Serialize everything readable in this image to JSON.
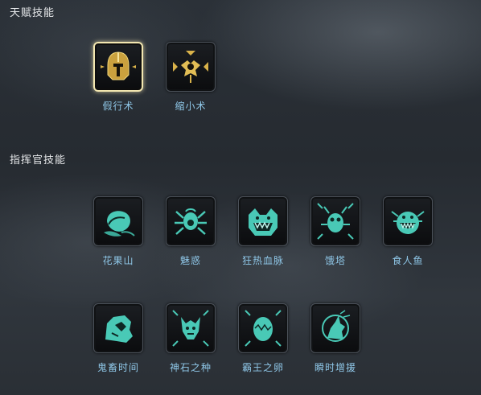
{
  "sections": {
    "talent": {
      "title": "天赋技能",
      "skills": [
        {
          "label": "假行术",
          "icon": "golden-helmet-icon",
          "selected": true
        },
        {
          "label": "缩小术",
          "icon": "golden-shrink-icon",
          "selected": false
        }
      ]
    },
    "commander": {
      "title": "指挥官技能",
      "skills": [
        {
          "label": "花果山",
          "icon": "peach-icon"
        },
        {
          "label": "魅惑",
          "icon": "charm-spider-icon"
        },
        {
          "label": "狂热血脉",
          "icon": "fanged-beast-icon"
        },
        {
          "label": "饿塔",
          "icon": "insect-tower-icon"
        },
        {
          "label": "食人鱼",
          "icon": "piranha-icon"
        },
        {
          "label": "鬼畜时间",
          "icon": "ghost-beast-icon"
        },
        {
          "label": "神石之种",
          "icon": "demon-stone-icon"
        },
        {
          "label": "霸王之卵",
          "icon": "egg-icon"
        },
        {
          "label": "瞬时增援",
          "icon": "wolf-howl-icon"
        }
      ]
    }
  },
  "colors": {
    "gold": "#d9b24a",
    "teal": "#49c9b6",
    "label": "#8fc7e8",
    "title": "#e6e8ea"
  }
}
